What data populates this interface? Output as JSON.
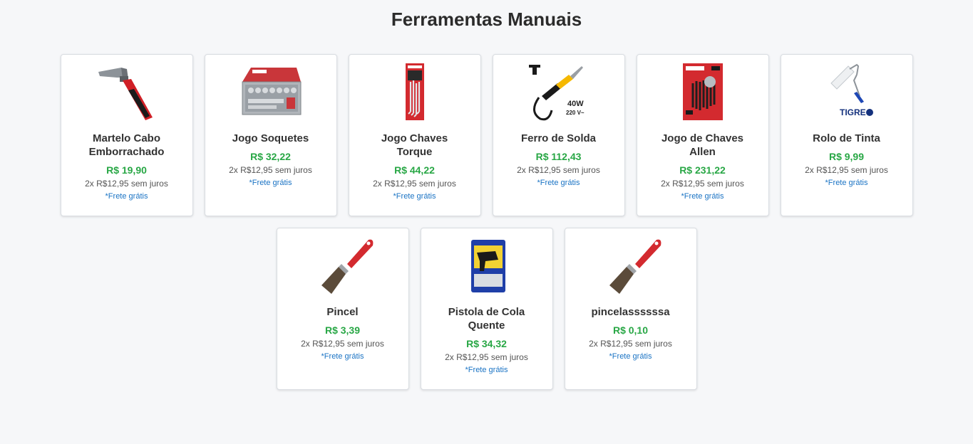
{
  "page": {
    "title": "Ferramentas Manuais"
  },
  "colors": {
    "price": "#28a745",
    "shipping": "#1a73c4",
    "background": "#f6f7f9"
  },
  "products": [
    {
      "name": "Martelo Cabo Emborrachado",
      "price": "R$ 19,90",
      "installments": "2x R$12,95 sem juros",
      "shipping": "*Frete grátis",
      "image": "hammer-image"
    },
    {
      "name": "Jogo Soquetes",
      "price": "R$ 32,22",
      "installments": "2x R$12,95 sem juros",
      "shipping": "*Frete grátis",
      "image": "socket-set-image"
    },
    {
      "name": "Jogo Chaves Torque",
      "price": "R$ 44,22",
      "installments": "2x R$12,95 sem juros",
      "shipping": "*Frete grátis",
      "image": "torx-keys-image"
    },
    {
      "name": "Ferro de Solda",
      "price": "R$ 112,43",
      "installments": "2x R$12,95 sem juros",
      "shipping": "*Frete grátis",
      "image": "soldering-iron-image",
      "image_text": [
        "40W",
        "220 V~"
      ]
    },
    {
      "name": "Jogo de Chaves Allen",
      "price": "R$ 231,22",
      "installments": "2x R$12,95 sem juros",
      "shipping": "*Frete grátis",
      "image": "allen-keys-image"
    },
    {
      "name": "Rolo de Tinta",
      "price": "R$ 9,99",
      "installments": "2x R$12,95 sem juros",
      "shipping": "*Frete grátis",
      "image": "paint-roller-image",
      "image_text": [
        "TIGRE"
      ]
    },
    {
      "name": "Pincel",
      "price": "R$ 3,39",
      "installments": "2x R$12,95 sem juros",
      "shipping": "*Frete grátis",
      "image": "paintbrush-image"
    },
    {
      "name": "Pistola de Cola Quente",
      "price": "R$ 34,32",
      "installments": "2x R$12,95 sem juros",
      "shipping": "*Frete grátis",
      "image": "glue-gun-image"
    },
    {
      "name": "pincelassssssa",
      "price": "R$ 0,10",
      "installments": "2x R$12,95 sem juros",
      "shipping": "*Frete grátis",
      "image": "paintbrush-image"
    }
  ]
}
